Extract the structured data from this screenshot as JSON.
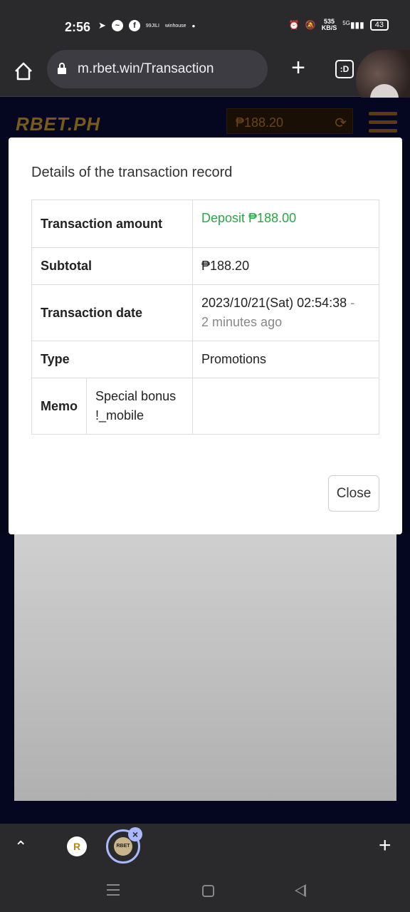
{
  "status_bar": {
    "time": "2:56",
    "left_icon_texts": [
      "99JILI",
      "winhouse"
    ],
    "network_speed_value": "535",
    "network_speed_unit": "KB/S",
    "network_type": "5G",
    "battery": "43"
  },
  "browser": {
    "url": "m.rbet.win/Transaction",
    "tabs_badge": ":D"
  },
  "header": {
    "logo": "RBET.PH",
    "balance": "₱188.20"
  },
  "modal": {
    "title": "Details of the transaction record",
    "rows": {
      "amount": {
        "label": "Transaction amount",
        "value": "Deposit ₱188.00"
      },
      "subtotal": {
        "label": "Subtotal",
        "value": "₱188.20"
      },
      "date": {
        "label": "Transaction date",
        "value": "2023/10/21(Sat) 02:54:38",
        "separator": " -",
        "relative": "2 minutes ago"
      },
      "type": {
        "label": "Type",
        "value": "Promotions"
      },
      "memo": {
        "label": "Memo",
        "sub": "Special bonus !_mobile",
        "value": ""
      }
    },
    "close_label": "Close"
  },
  "tabstrip": {
    "tab2_label": "RBET"
  },
  "colors": {
    "deposit_green": "#28a745",
    "page_bg": "#050720",
    "chrome_bg": "#2a2a2d"
  }
}
